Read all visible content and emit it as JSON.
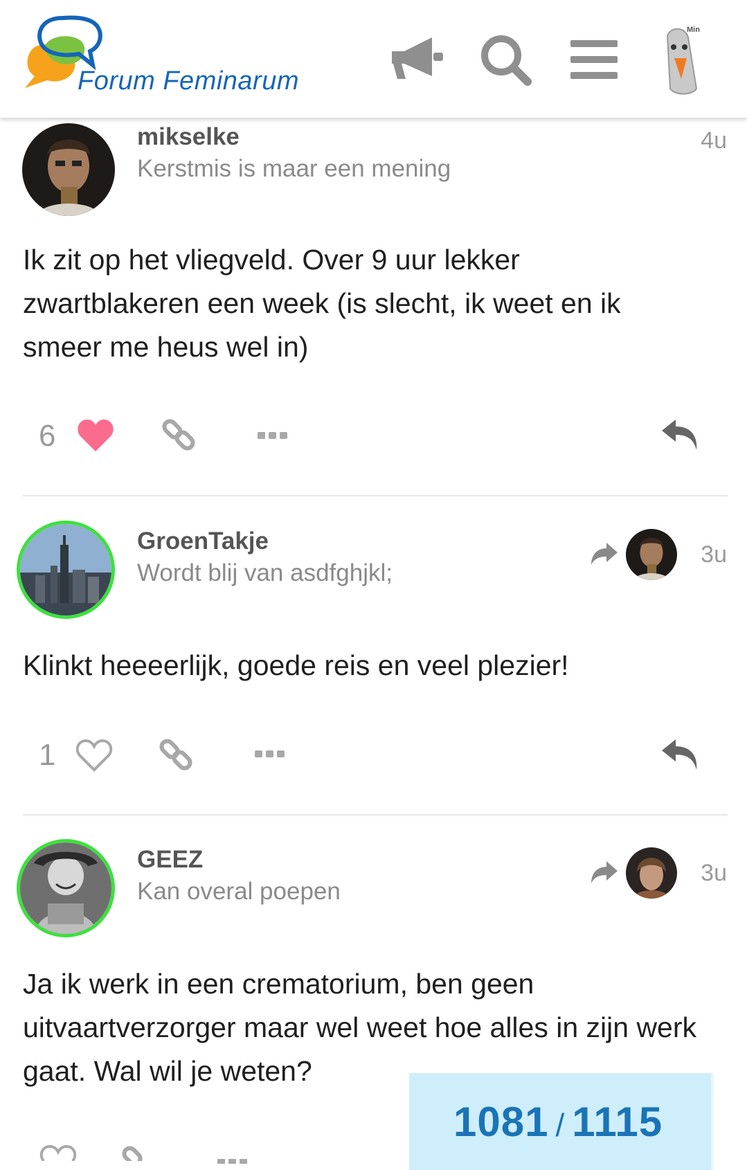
{
  "header": {
    "brand": "Forum Feminarum",
    "icons": [
      "megaphone-icon",
      "search-icon",
      "menu-icon",
      "user-avatar"
    ],
    "avatar_badge": "Min"
  },
  "posts": [
    {
      "username": "mikselke",
      "user_title": "Kerstmis is maar een mening",
      "age": "4u",
      "body": "Ik zit op het vliegveld. Over 9 uur lekker zwartblakeren een week (is slecht, ik weet en ik smeer me heus wel in)",
      "likes": "6",
      "liked": true
    },
    {
      "username": "GroenTakje",
      "user_title": "Wordt blij van asdfghjkl;",
      "age": "3u",
      "body": "Klinkt heeeerlijk, goede reis en veel plezier!",
      "likes": "1",
      "liked": false
    },
    {
      "username": "GEEZ",
      "user_title": "Kan overal poepen",
      "age": "3u",
      "body": "Ja ik werk in een crematorium, ben geen uitvaartverzorger maar wel weet hoe alles in zijn werk gaat. Wal wil je weten?",
      "likes": "",
      "liked": false
    }
  ],
  "progress": {
    "current": "1081",
    "separator": "/",
    "total": "1115"
  },
  "colors": {
    "brand": "#1565b8",
    "like_active": "#fa6c8d",
    "online_ring": "#3ee03e",
    "progress_bg": "#cfeefb",
    "progress_text": "#1a74b6"
  }
}
